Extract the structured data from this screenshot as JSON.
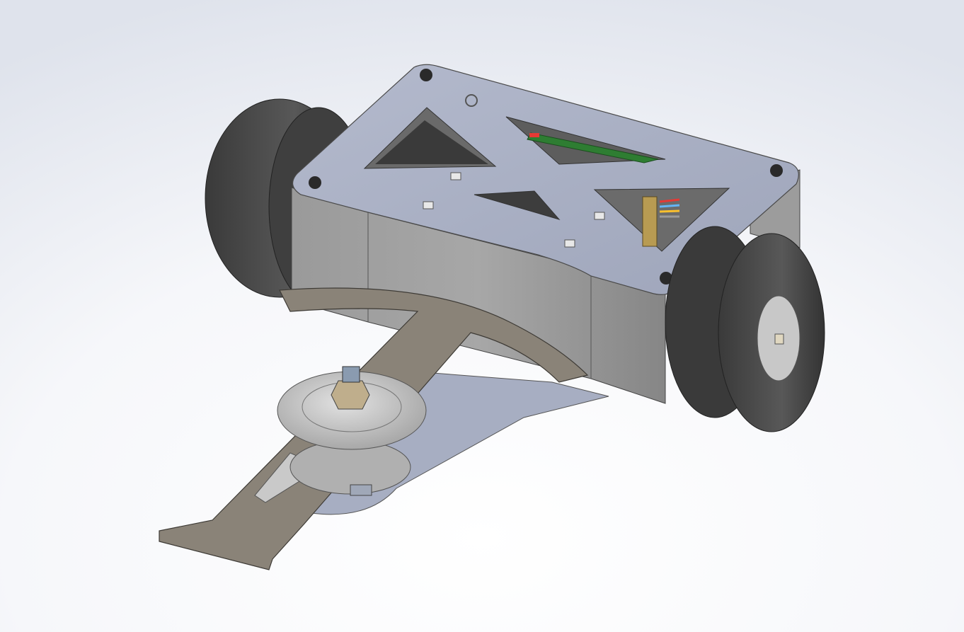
{
  "scene": {
    "description_type": "cad-model-viewport",
    "colors": {
      "background_top": "#e4e8f0",
      "background_mid": "#f7f8fb",
      "background_bottom": "#ffffff",
      "plate": "#a9b0c4",
      "plate_dark": "#8d93a6",
      "side_wall": "#8f8f8f",
      "arm": "#8a8378",
      "arm_dark": "#6b655d",
      "tire": "#4a4a4a",
      "tire_dark": "#2e2e2e",
      "hub": "#c8c8c8",
      "pcb_green": "#2e7d32",
      "wire_red": "#e53935",
      "wire_blue": "#64b5f6",
      "wire_yellow": "#fbc02d"
    },
    "parts": [
      "top-plate",
      "bottom-plate",
      "side-wall",
      "left-wheel",
      "right-wheel",
      "wedge-arm",
      "pivot-bearing",
      "pcb-board",
      "connector-header"
    ]
  }
}
